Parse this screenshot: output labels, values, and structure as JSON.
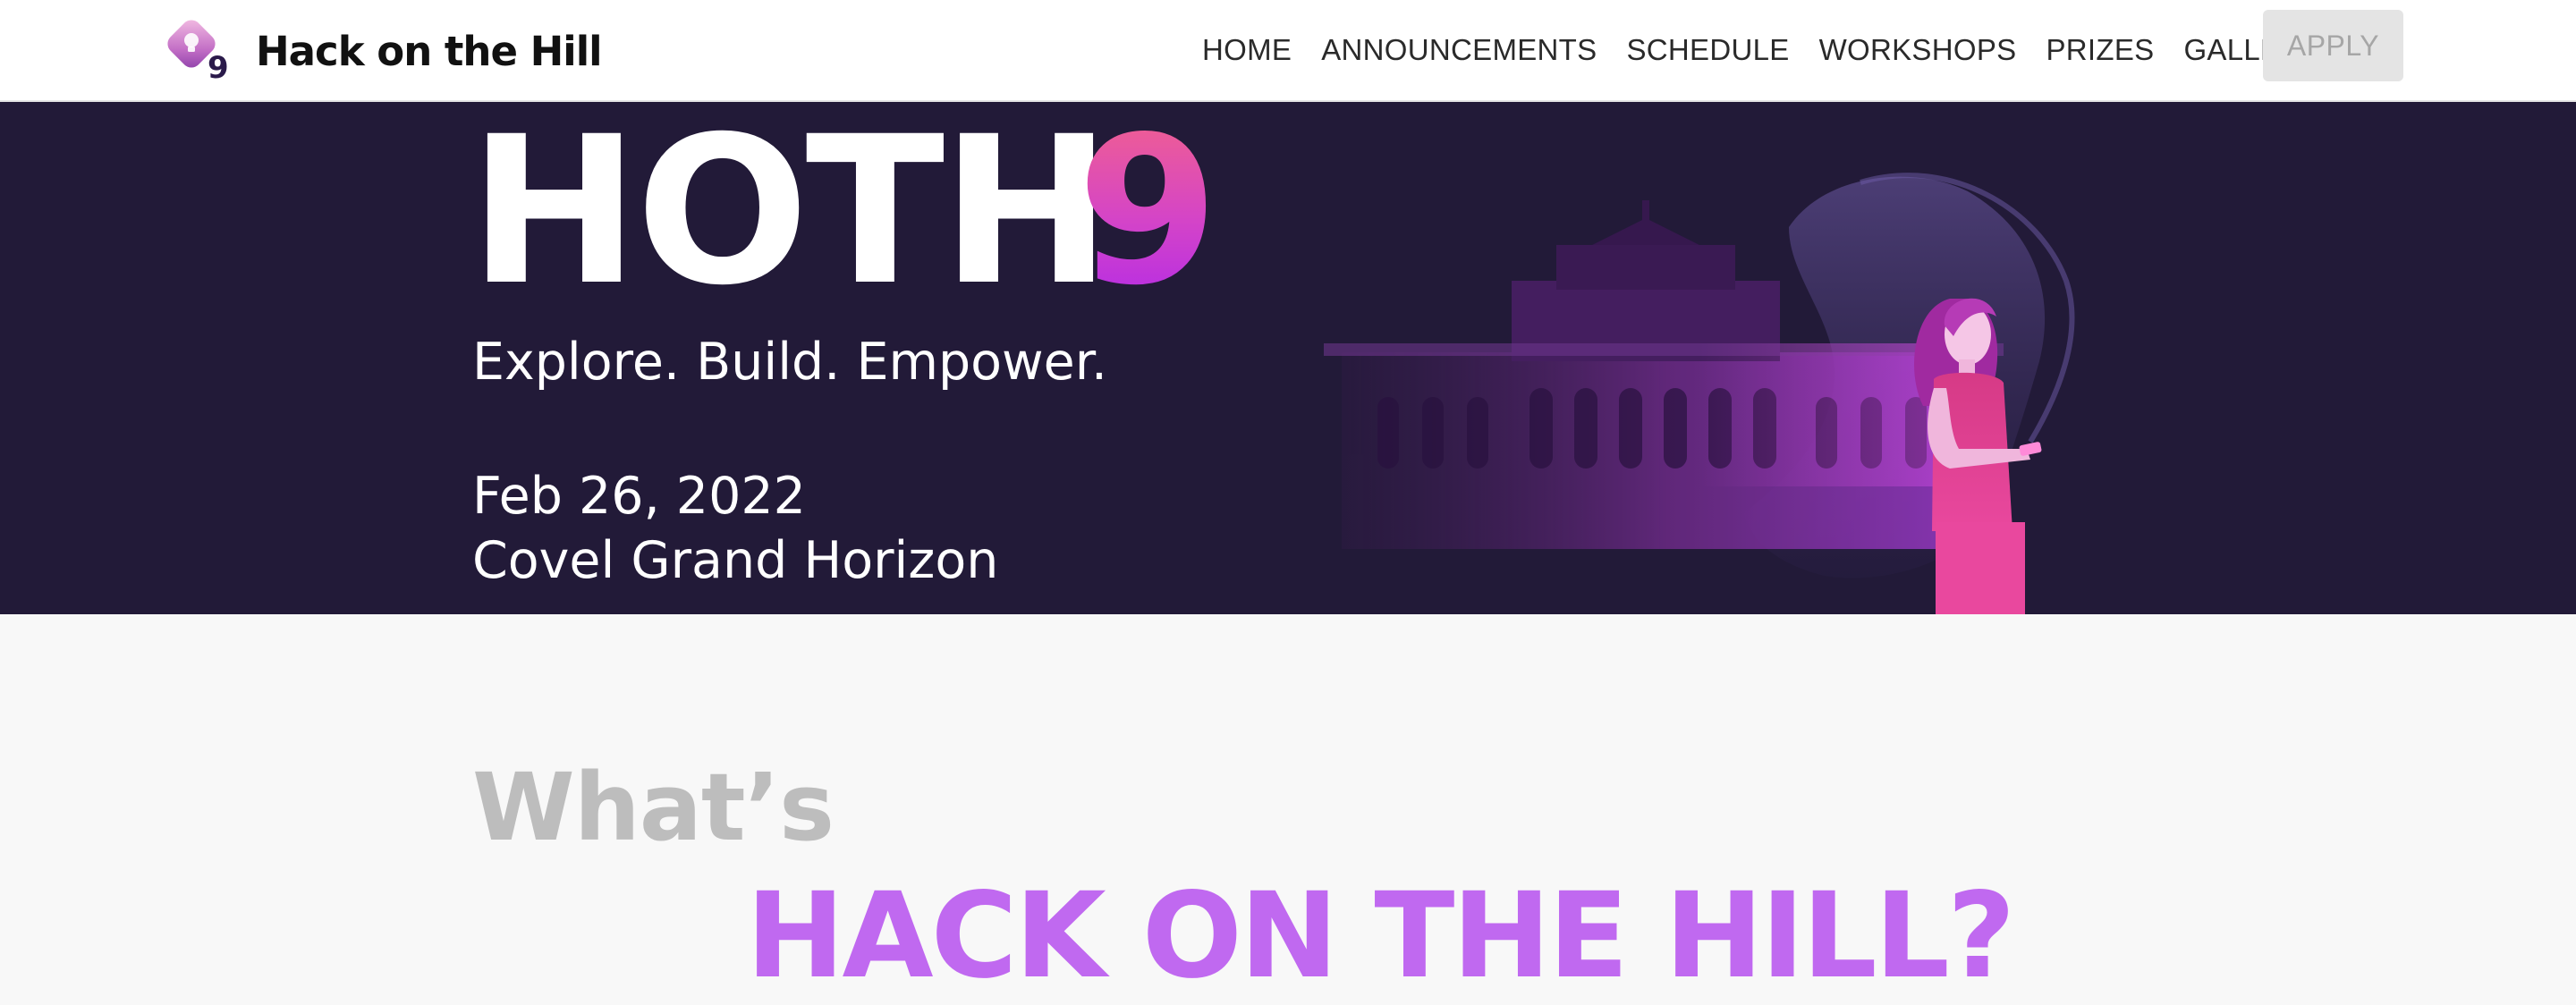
{
  "nav": {
    "brand": "Hack on the Hill",
    "logo_badge": "9",
    "links": [
      {
        "label": "HOME"
      },
      {
        "label": "ANNOUNCEMENTS"
      },
      {
        "label": "SCHEDULE"
      },
      {
        "label": "WORKSHOPS"
      },
      {
        "label": "PRIZES"
      },
      {
        "label": "GALLERY"
      }
    ],
    "apply_label": "APPLY"
  },
  "hero": {
    "title": "HOTH",
    "number": "9",
    "tagline": "Explore. Build. Empower.",
    "date": "Feb 26, 2022",
    "venue": "Covel Grand Horizon"
  },
  "about": {
    "lead": "What’s",
    "heading": "HACK ON THE HILL?"
  },
  "colors": {
    "navbar_bg": "#ffffff",
    "hero_bg": "#221a38",
    "accent_purple": "#c069f0",
    "accent_pink": "#e9489e",
    "page_bg": "#f8f8f8",
    "apply_bg": "#e4e4e4"
  },
  "icons": {
    "logo": "lightbulb-diamond-icon",
    "illustration": "girl-with-phone-and-royce-hall-illustration"
  }
}
